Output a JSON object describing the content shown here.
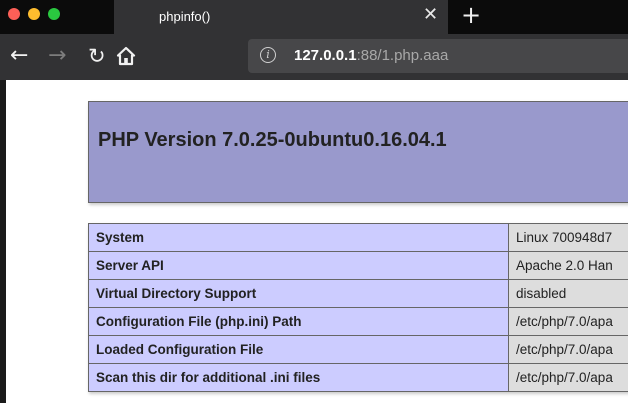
{
  "browser": {
    "tab": {
      "title": "phpinfo()"
    },
    "address": {
      "host": "127.0.0.1",
      "rest": ":88/1.php.aaa"
    }
  },
  "page": {
    "title": "PHP Version 7.0.25-0ubuntu0.16.04.1",
    "rows": [
      {
        "key": "System",
        "value": "Linux 700948d7"
      },
      {
        "key": "Server API",
        "value": "Apache 2.0 Han"
      },
      {
        "key": "Virtual Directory Support",
        "value": "disabled"
      },
      {
        "key": "Configuration File (php.ini) Path",
        "value": "/etc/php/7.0/apa"
      },
      {
        "key": "Loaded Configuration File",
        "value": "/etc/php/7.0/apa"
      },
      {
        "key": "Scan this dir for additional .ini files",
        "value": "/etc/php/7.0/apa"
      }
    ]
  }
}
